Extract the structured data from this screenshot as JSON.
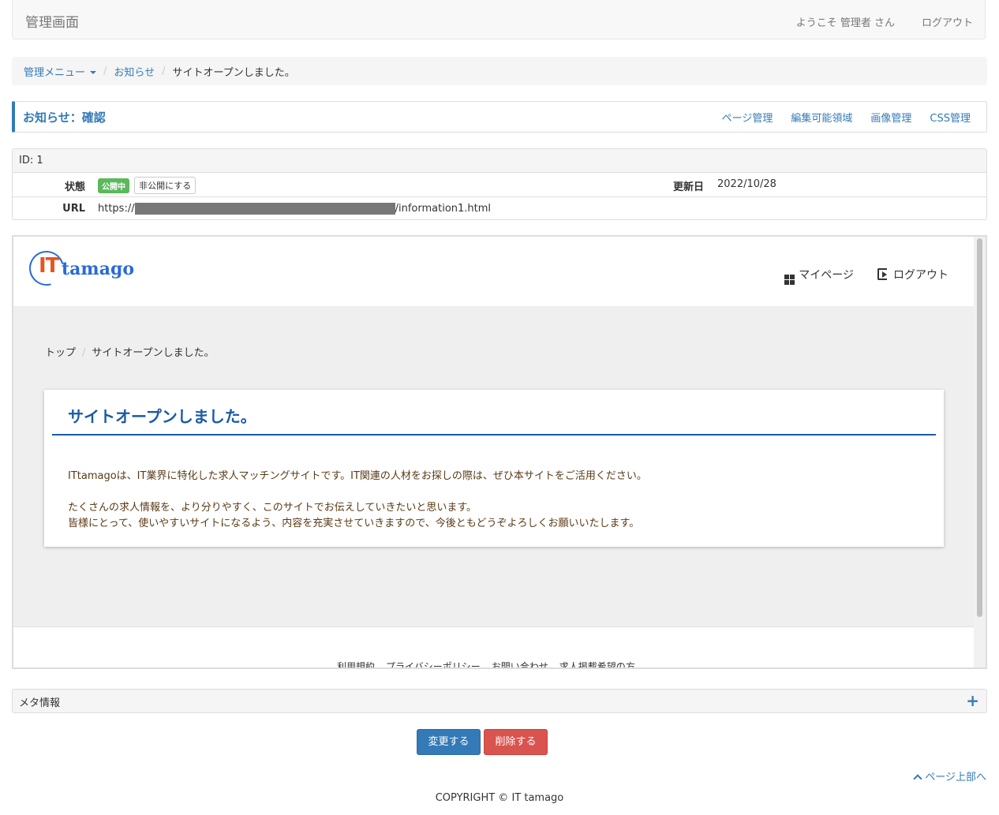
{
  "navbar": {
    "brand": "管理画面",
    "welcome": "ようこそ 管理者 さん",
    "logout": "ログアウト"
  },
  "breadcrumb": {
    "menu": "管理メニュー",
    "section": "お知らせ",
    "current": "サイトオープンしました。"
  },
  "titlebar": {
    "title": "お知らせ：確認",
    "tools": [
      "ページ管理",
      "編集可能領域",
      "画像管理",
      "CSS管理"
    ]
  },
  "info": {
    "id_label": "ID: 1",
    "status_label": "状態",
    "status_badge": "公開中",
    "status_button": "非公開にする",
    "updated_label": "更新日",
    "updated_value": "2022/10/28",
    "url_label": "URL",
    "url_prefix": "https://",
    "url_suffix": "/information1.html"
  },
  "preview": {
    "logo_it": "IT",
    "logo_tamago": "tamago",
    "nav_mypage": "マイページ",
    "nav_logout": "ログアウト",
    "crumb_top": "トップ",
    "crumb_current": "サイトオープンしました。",
    "article_title": "サイトオープンしました。",
    "paragraph1": "ITtamagoは、IT業界に特化した求人マッチングサイトです。IT関連の人材をお探しの際は、ぜひ本サイトをご活用ください。",
    "paragraph2_line1": "たくさんの求人情報を、より分りやすく、このサイトでお伝えしていきたいと思います。",
    "paragraph2_line2": "皆様にとって、使いやすいサイトになるよう、内容を充実させていきますので、今後ともどうぞよろしくお願いいたします。",
    "footer_links": [
      "利用規約",
      "プライバシーポリシー",
      "お問い合わせ",
      "求人掲載希望の方"
    ]
  },
  "meta": {
    "title": "メタ情報",
    "expand_symbol": "+"
  },
  "actions": {
    "edit": "変更する",
    "delete": "削除する"
  },
  "footer": {
    "to_top": "ページ上部へ",
    "copyright": "COPYRIGHT © IT tamago"
  },
  "colors": {
    "accent": "#337ab7",
    "danger": "#d9534f",
    "success": "#5cb85c",
    "article_title": "#1a5aa8",
    "article_text": "#5a3b16"
  }
}
